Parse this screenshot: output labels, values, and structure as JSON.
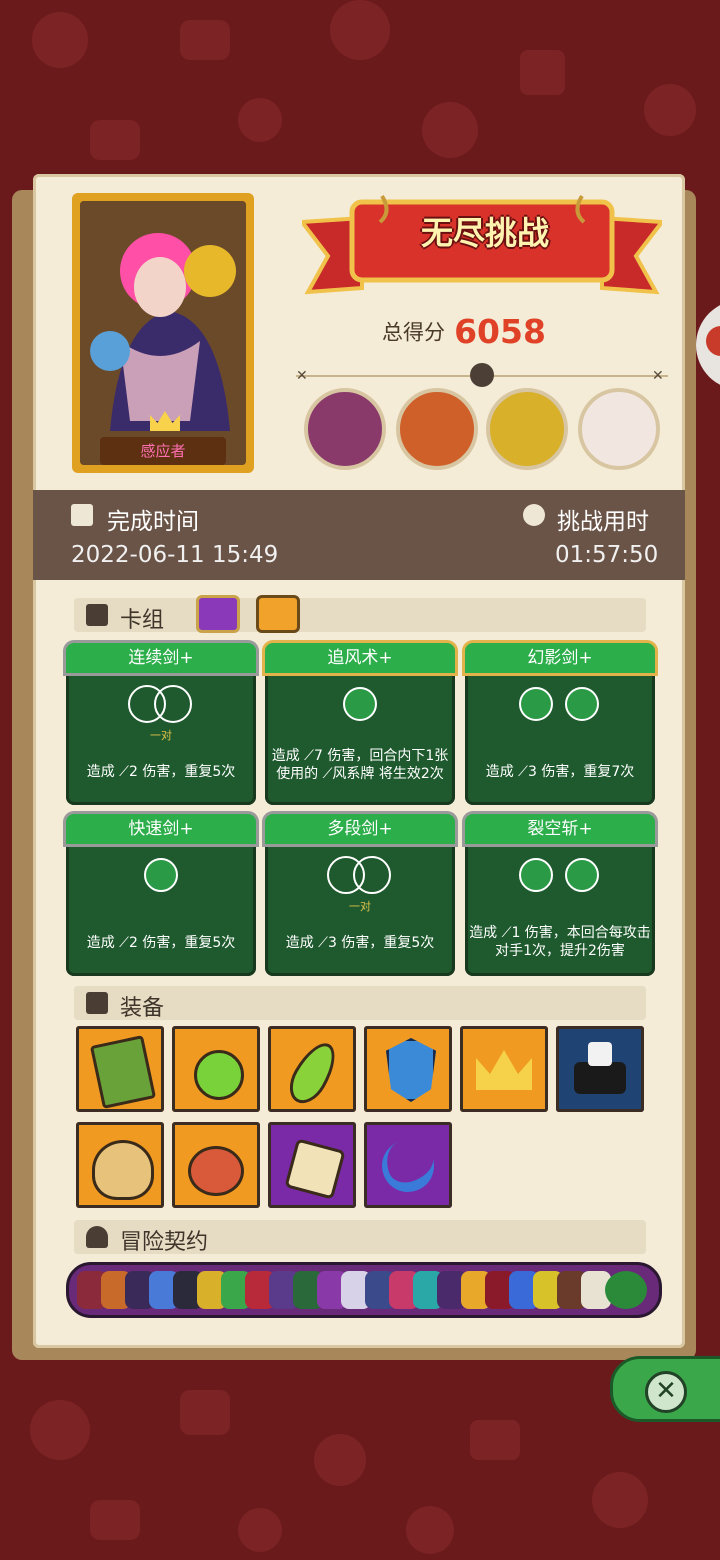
{
  "hero": {
    "name": "感应者"
  },
  "challenge": {
    "title": "无尽挑战",
    "score_label": "总得分",
    "score": "6058"
  },
  "time": {
    "finish_label": "完成时间",
    "finish_value": "2022-06-11 15:49",
    "duration_label": "挑战用时",
    "duration_value": "01:57:50"
  },
  "deck": {
    "title": "卡组",
    "cards": [
      {
        "name": "连续剑+",
        "tag": "一对",
        "desc": "造成 ⟋2 伤害，重复5次"
      },
      {
        "name": "追风术+",
        "tag": "",
        "desc": "造成 ⟋7 伤害，回合内下1张使用的 ⟋风系牌 将生效2次"
      },
      {
        "name": "幻影剑+",
        "tag": "",
        "desc": "造成 ⟋3 伤害，重复7次"
      },
      {
        "name": "快速剑+",
        "tag": "",
        "desc": "造成 ⟋2 伤害，重复5次"
      },
      {
        "name": "多段剑+",
        "tag": "一对",
        "desc": "造成 ⟋3 伤害，重复5次"
      },
      {
        "name": "裂空斩+",
        "tag": "",
        "desc": "造成 ⟋1 伤害，本回合每攻击对手1次，提升2伤害"
      }
    ]
  },
  "equipment": {
    "title": "装备",
    "items": [
      "book-icon",
      "potion-icon",
      "feather-icon",
      "shield-gem-icon",
      "crown-icon",
      "magic-hat-dice-icon",
      "money-bag-icon",
      "meat-icon",
      "spiked-dice-icon",
      "moon-blade-icon"
    ]
  },
  "contracts": {
    "title": "冒险契约"
  },
  "colors": {
    "accent": "#e04228",
    "card_green": "#2cae4b",
    "panel_brown": "#6a5347"
  }
}
